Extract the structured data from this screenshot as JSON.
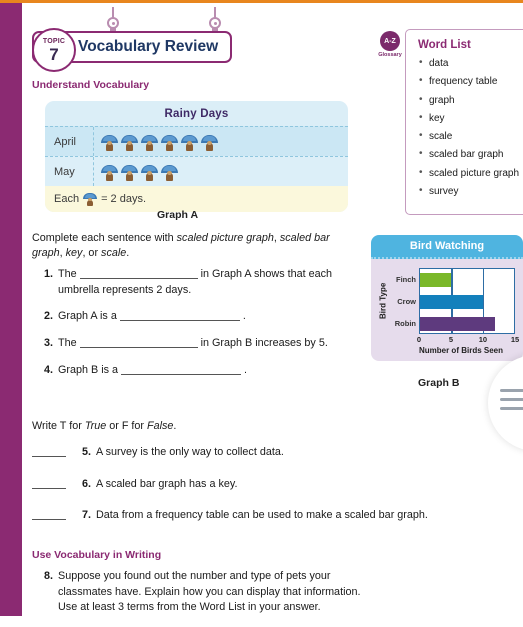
{
  "topic": {
    "label": "TOPIC",
    "number": "7",
    "title": "Vocabulary Review"
  },
  "sections": {
    "understand": "Understand Vocabulary",
    "writing": "Use Vocabulary in Writing"
  },
  "graph_a": {
    "title": "Rainy Days",
    "caption": "Graph A",
    "rows": [
      {
        "label": "April",
        "icons": 6
      },
      {
        "label": "May",
        "icons": 4
      }
    ],
    "key_prefix": "Each",
    "key_suffix": "= 2 days."
  },
  "instructions": {
    "fill_in": "Complete each sentence with scaled picture graph, scaled bar graph, key, or scale.",
    "true_false": "Write T for True or F for False."
  },
  "questions": [
    {
      "num": "1.",
      "before": "The",
      "after": "in Graph A shows that each umbrella represents 2 days.",
      "blank": true
    },
    {
      "num": "2.",
      "before": "Graph A is a",
      "after": ".",
      "blank": true
    },
    {
      "num": "3.",
      "before": "The",
      "after": "in Graph B increases by 5.",
      "blank": true
    },
    {
      "num": "4.",
      "before": "Graph B is a",
      "after": ".",
      "blank": true
    }
  ],
  "true_false_items": [
    {
      "num": "5.",
      "text": "A survey is the only way to collect data."
    },
    {
      "num": "6.",
      "text": "A scaled bar graph has a key."
    },
    {
      "num": "7.",
      "text": "Data from a frequency table can be used to make a scaled bar graph."
    }
  ],
  "writing_question": {
    "num": "8.",
    "text": "Suppose you found out the number and type of pets your classmates have. Explain how you can display that information. Use at least 3 terms from the Word List in your answer."
  },
  "glossary_icon": {
    "text": "A-Z",
    "label": "Glossary"
  },
  "word_list": {
    "title": "Word List",
    "items": [
      "data",
      "frequency table",
      "graph",
      "key",
      "scale",
      "scaled bar graph",
      "scaled picture graph",
      "survey"
    ]
  },
  "chart_data": {
    "type": "bar",
    "title": "Bird Watching",
    "caption": "Graph B",
    "orientation": "horizontal",
    "categories": [
      "Finch",
      "Crow",
      "Robin"
    ],
    "values": [
      5,
      10,
      12
    ],
    "colors": [
      "#7AB829",
      "#1380BC",
      "#5E3A7E"
    ],
    "xlabel": "Number of Birds Seen",
    "ylabel": "Bird Type",
    "xlim": [
      0,
      15
    ],
    "xticks": [
      "0",
      "5",
      "10",
      "15"
    ],
    "grid": true,
    "legend": "none"
  },
  "menu_button": {
    "name": "menu"
  }
}
